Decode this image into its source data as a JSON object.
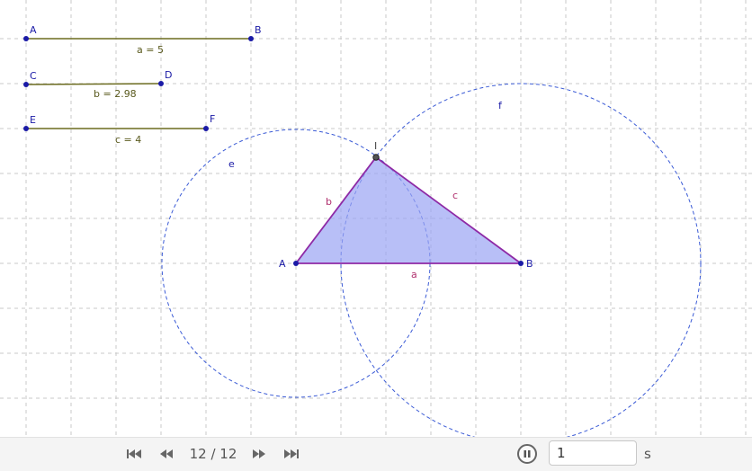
{
  "construction": {
    "segments": [
      {
        "start_label": "A",
        "end_label": "B",
        "value_label": "a = 5"
      },
      {
        "start_label": "C",
        "end_label": "D",
        "value_label": "b = 2.98"
      },
      {
        "start_label": "E",
        "end_label": "F",
        "value_label": "c = 4"
      }
    ],
    "triangle": {
      "vertex_a": "A",
      "vertex_b": "B",
      "vertex_top": "I",
      "side_a": "a",
      "side_b": "b",
      "side_c": "c"
    },
    "circles": {
      "left": "e",
      "right": "f"
    },
    "colors": {
      "grid": "#c8c8c8",
      "segment": "#6b6b1f",
      "point": "#1a1aa6",
      "triangle_stroke": "#8e2aa6",
      "triangle_fill": "#9aa4f4",
      "circle": "#3b5bd6"
    }
  },
  "toolbar": {
    "first_icon": "skip-to-start-icon",
    "prev_icon": "rewind-icon",
    "step_text": "12 / 12",
    "next_icon": "fast-forward-icon",
    "last_icon": "skip-to-end-icon",
    "pause_icon": "pause-icon",
    "speed_value": "1",
    "speed_unit": "s"
  }
}
